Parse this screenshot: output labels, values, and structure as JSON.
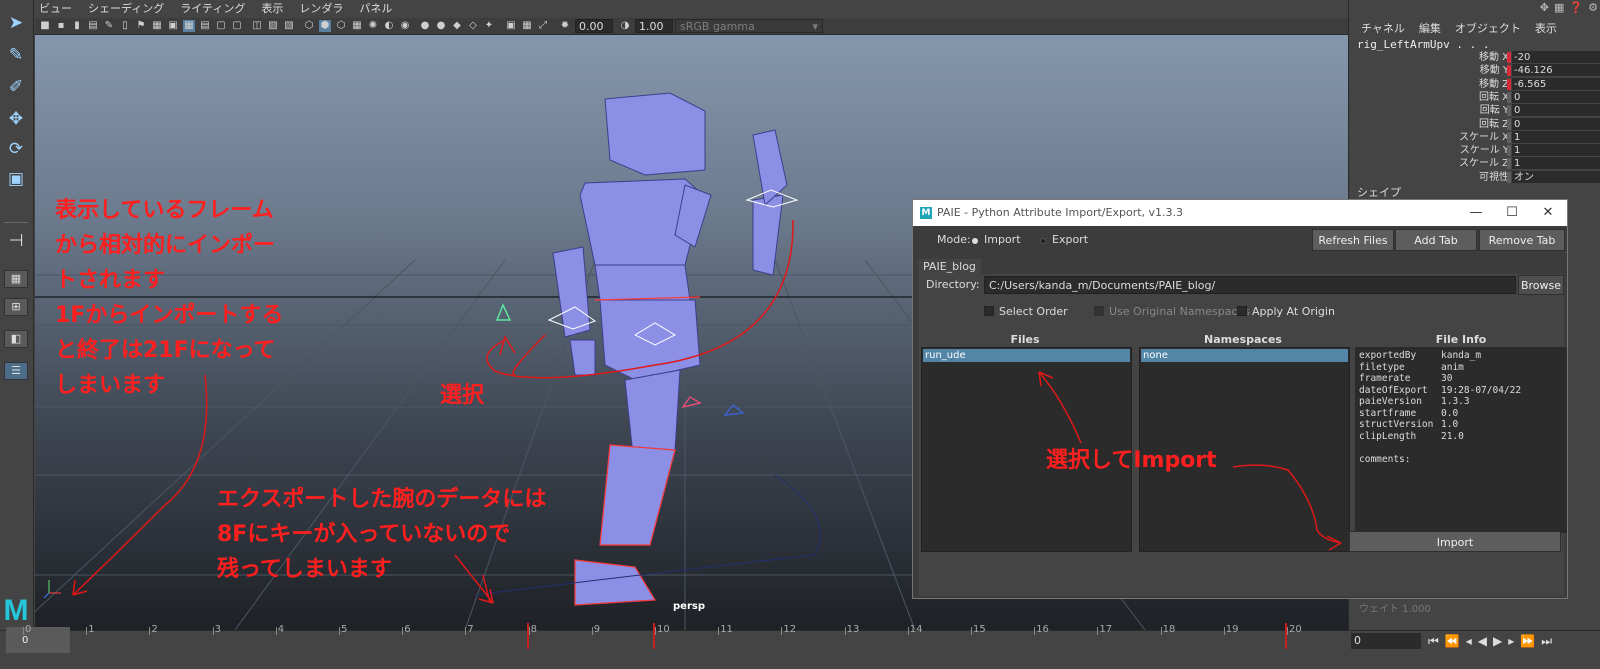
{
  "viewport": {
    "menu": [
      "ビュー",
      "シェーディング",
      "ライティング",
      "表示",
      "レンダラ",
      "パネル"
    ],
    "exposure": "0.00",
    "gamma": "1.00",
    "colorspace": "sRGB gamma",
    "camera_label": "persp"
  },
  "annotations": {
    "left_note": "表示しているフレーム\nから相対的にインポー\nトされます\n1Fからインポートする\nと終了は21Fになって\nしまいます",
    "select_label": "選択",
    "bottom_note": "エクスポートした腕のデータには\n8Fにキーが入っていないので\n残ってしまいます",
    "import_note": "選択してImport"
  },
  "channel_box": {
    "menu": [
      "チャネル",
      "編集",
      "オブジェクト",
      "表示"
    ],
    "node": "rig_LeftArmUpv . . .",
    "attributes": [
      {
        "label": "移動 X",
        "value": "-20",
        "keyed": true
      },
      {
        "label": "移動 Y",
        "value": "-46.126",
        "keyed": true
      },
      {
        "label": "移動 Z",
        "value": "-6.565",
        "keyed": true
      },
      {
        "label": "回転 X",
        "value": "0",
        "keyed": false
      },
      {
        "label": "回転 Y",
        "value": "0",
        "keyed": false
      },
      {
        "label": "回転 Z",
        "value": "0",
        "keyed": false
      },
      {
        "label": "スケール X",
        "value": "1",
        "keyed": false
      },
      {
        "label": "スケール Y",
        "value": "1",
        "keyed": false
      },
      {
        "label": "スケール Z",
        "value": "1",
        "keyed": false
      },
      {
        "label": "可視性",
        "value": "オン",
        "keyed": false
      }
    ],
    "shape_header": "シェイプ",
    "weight_label": "ウェイト 1.000",
    "colors": {
      "keyed": "#d6293a",
      "field": "#2b2b2b"
    }
  },
  "paie": {
    "title": "PAIE - Python Attribute Import/Export, v1.3.3",
    "logo": "M",
    "mode_label": "Mode:",
    "mode_import": "Import",
    "mode_export": "Export",
    "refresh_button": "Refresh Files",
    "add_tab_button": "Add Tab",
    "remove_tab_button": "Remove Tab",
    "tab_name": "PAIE_blog",
    "directory_label": "Directory:",
    "directory_value": "C:/Users/kanda_m/Documents/PAIE_blog/",
    "browse_button": "Browse",
    "select_order": "Select Order",
    "use_original_ns": "Use Original Namespaces",
    "apply_at_origin": "Apply At Origin",
    "files_header": "Files",
    "namespaces_header": "Namespaces",
    "fileinfo_header": "File Info",
    "selected_file": "run_ude",
    "selected_namespace": "none",
    "file_info": [
      {
        "key": "exportedBy",
        "value": "kanda_m"
      },
      {
        "key": "filetype",
        "value": "anim"
      },
      {
        "key": "framerate",
        "value": "30"
      },
      {
        "key": "dateOfExport",
        "value": "19:28-07/04/22"
      },
      {
        "key": "paieVersion",
        "value": "1.3.3"
      },
      {
        "key": "startframe",
        "value": "0.0"
      },
      {
        "key": "structVersion",
        "value": "1.0"
      },
      {
        "key": "clipLength",
        "value": "21.0"
      },
      {
        "key": "",
        "value": ""
      },
      {
        "key": "comments:",
        "value": ""
      }
    ],
    "import_button": "Import"
  },
  "timeline": {
    "ticks": [
      "0",
      "1",
      "2",
      "3",
      "4",
      "5",
      "6",
      "7",
      "8",
      "9",
      "10",
      "11",
      "12",
      "13",
      "14",
      "15",
      "16",
      "17",
      "18",
      "19",
      "20"
    ],
    "keyframes": [
      8,
      10,
      20
    ],
    "current_frame": "0",
    "frame_field": "0"
  }
}
